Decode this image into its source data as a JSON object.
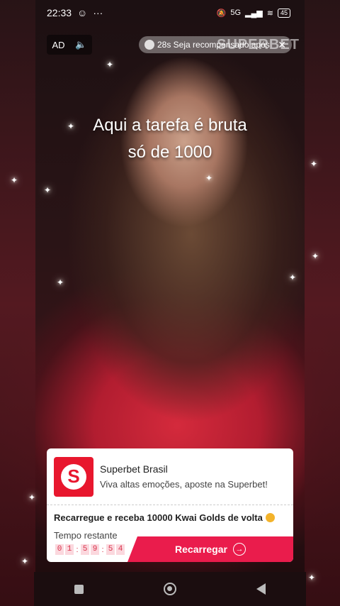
{
  "status": {
    "time": "22:33",
    "network": "5G",
    "battery": "45"
  },
  "ad": {
    "ad_label": "AD",
    "reward_text": "28s Seja recompensado após",
    "close_symbol": "✕",
    "watermark": "SUPERBET"
  },
  "caption": {
    "line1": "Aqui a tarefa é bruta",
    "line2": "só de 1000"
  },
  "card": {
    "advertiser": "Superbet Brasil",
    "tagline": "Viva altas emoções, aposte na Superbet!",
    "promo": "Recarregue e receba 10000 Kwai Golds de volta",
    "remaining_label": "Tempo restante",
    "countdown": [
      "0",
      "1",
      ":",
      "5",
      "9",
      ":",
      "5",
      "4"
    ],
    "cta": "Recarregar",
    "brand_color": "#e8172e",
    "cta_color": "#ea1c4c"
  },
  "icons": {
    "mute": "speaker-icon",
    "home": "home-icon",
    "recents": "recents-icon",
    "back": "back-icon"
  }
}
